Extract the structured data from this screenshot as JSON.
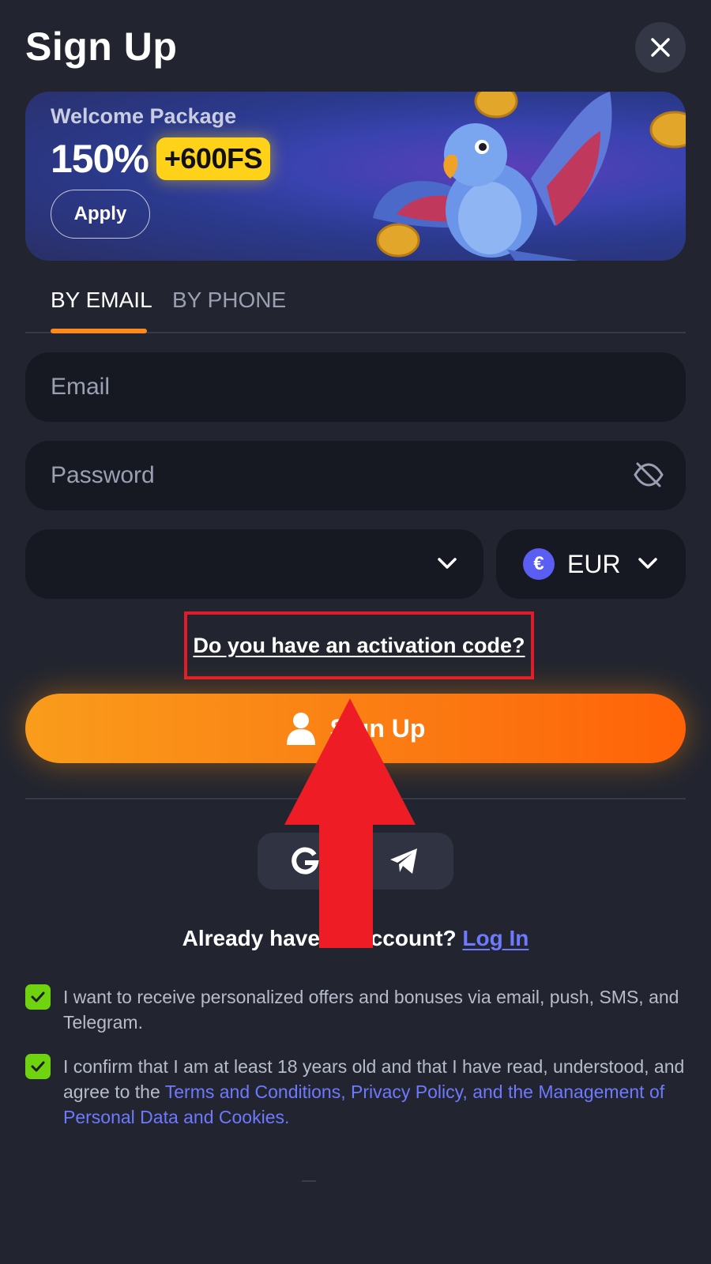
{
  "header": {
    "title": "Sign Up"
  },
  "banner": {
    "subtitle": "Welcome Package",
    "percent": "150%",
    "free_spins": "+600FS",
    "apply_label": "Apply"
  },
  "tabs": [
    {
      "label": "BY EMAIL",
      "active": true
    },
    {
      "label": "BY PHONE",
      "active": false
    }
  ],
  "form": {
    "email_placeholder": "Email",
    "password_placeholder": "Password",
    "country_value": "",
    "currency_symbol": "€",
    "currency_value": "EUR"
  },
  "activation": {
    "label": "Do you have an activation code?"
  },
  "signup": {
    "label": "Sign Up"
  },
  "social": {
    "icons": [
      "google-icon",
      "telegram-icon"
    ]
  },
  "login": {
    "prompt": "Already have an account?",
    "link": "Log In"
  },
  "consents": [
    {
      "checked": true,
      "text": "I want to receive personalized offers and bonuses via email, push, SMS, and Telegram."
    },
    {
      "checked": true,
      "text_before": "I confirm that I am at least 18 years old and that I have read, understood, and agree to the ",
      "link": "Terms and Conditions, Privacy Policy, and the Management of Personal Data and Cookies."
    }
  ],
  "colors": {
    "background": "#22252f",
    "field": "#161921",
    "accent_orange": "#fb7a12",
    "link_blue": "#6d79ff",
    "checkbox_green": "#6fd40f",
    "highlight_red": "#e01b2a"
  }
}
